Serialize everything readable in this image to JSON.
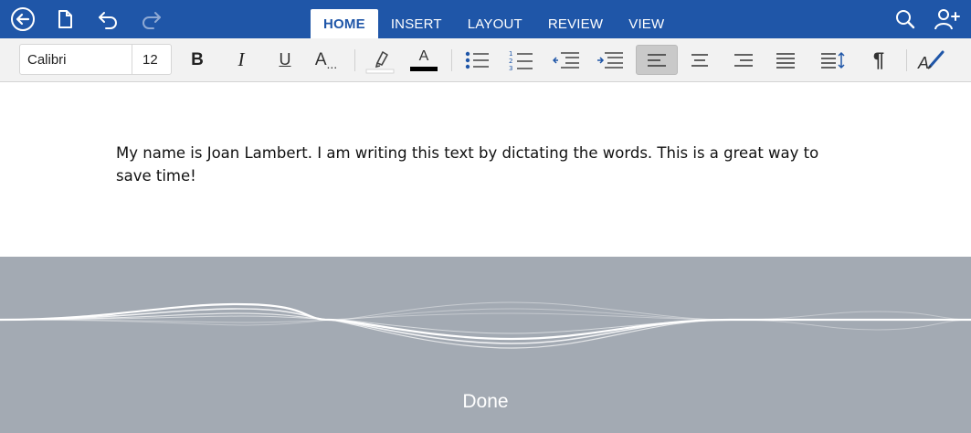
{
  "toolbar": {
    "icons": [
      "back-icon",
      "file-icon",
      "undo-icon",
      "redo-icon",
      "search-icon",
      "share-icon"
    ]
  },
  "tabs": [
    {
      "label": "HOME",
      "active": true
    },
    {
      "label": "INSERT",
      "active": false
    },
    {
      "label": "LAYOUT",
      "active": false
    },
    {
      "label": "REVIEW",
      "active": false
    },
    {
      "label": "VIEW",
      "active": false
    }
  ],
  "ribbon": {
    "font_name": "Calibri",
    "font_size": "12",
    "bold": "B",
    "italic": "I",
    "underline": "U",
    "styles": "A",
    "font_color": "A",
    "paragraph_mark": "¶",
    "selected_alignment": "align-left"
  },
  "document": {
    "text": "My name is Joan Lambert. I am writing this text by dictating the words. This is a great way to save time!"
  },
  "dictation": {
    "done_label": "Done"
  },
  "colors": {
    "accent": "#1f56a8",
    "ribbon": "#f2f2f2",
    "dictation_bg": "#a3aab3"
  }
}
